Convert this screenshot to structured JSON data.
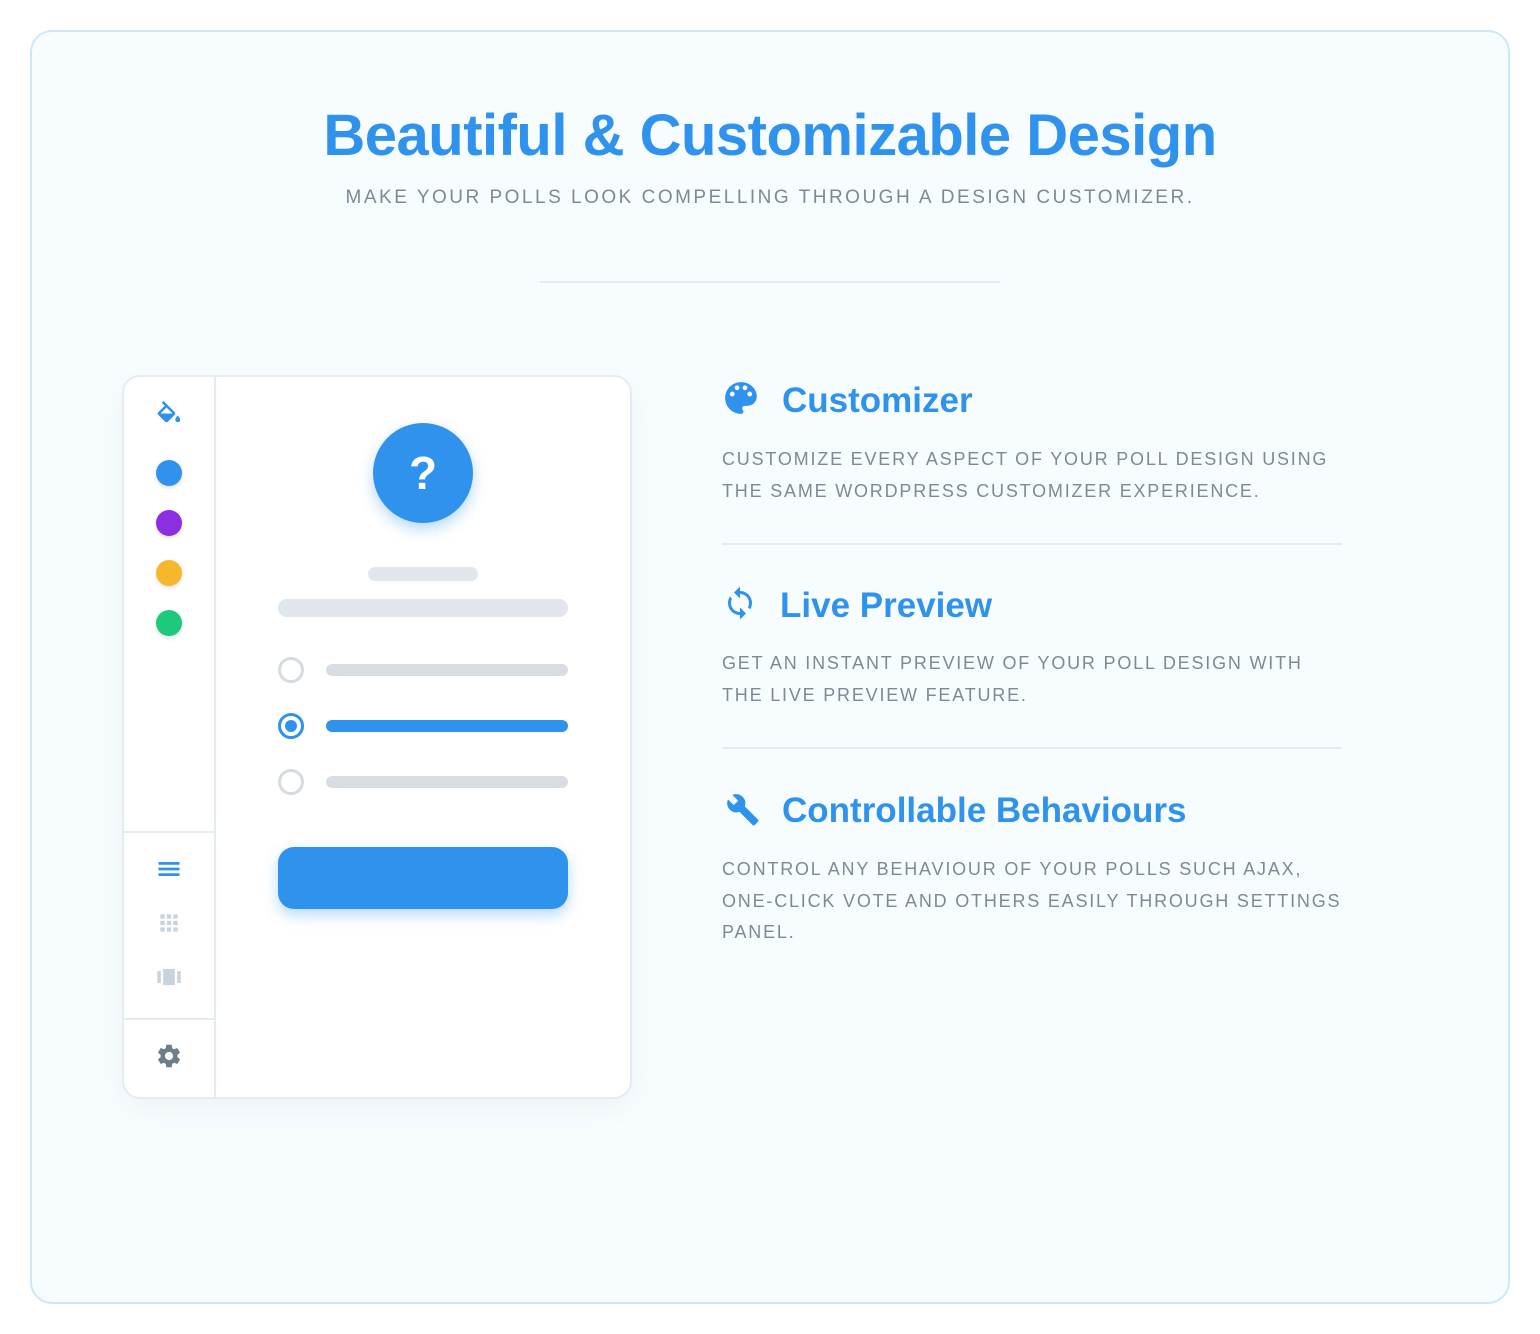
{
  "header": {
    "title": "Beautiful & Customizable Design",
    "subtitle": "MAKE YOUR POLLS LOOK COMPELLING THROUGH A DESIGN CUSTOMIZER."
  },
  "mockup": {
    "question_mark": "?",
    "swatches": [
      "blue",
      "purple",
      "orange",
      "green"
    ]
  },
  "features": [
    {
      "icon": "palette-icon",
      "title": "Customizer",
      "desc": "CUSTOMIZE EVERY ASPECT OF YOUR POLL DESIGN USING THE SAME WORDPRESS CUSTOMIZER EXPERIENCE."
    },
    {
      "icon": "sync-icon",
      "title": "Live Preview",
      "desc": "GET AN INSTANT PREVIEW OF YOUR POLL DESIGN WITH THE LIVE PREVIEW FEATURE."
    },
    {
      "icon": "wrench-icon",
      "title": "Controllable Behaviours",
      "desc": "CONTROL ANY BEHAVIOUR OF YOUR POLLS SUCH AJAX, ONE-CLICK VOTE AND OTHERS EASILY THROUGH SETTINGS PANEL."
    }
  ]
}
